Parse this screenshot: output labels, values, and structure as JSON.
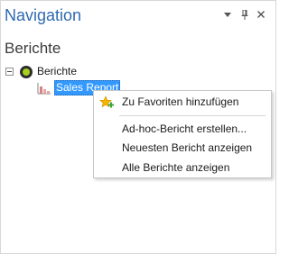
{
  "pane": {
    "title": "Navigation",
    "section_title": "Berichte"
  },
  "tree": {
    "root": {
      "label": "Berichte",
      "expanded": true,
      "status_color": "#a8d11d"
    },
    "child": {
      "label": "Sales Report",
      "selected": true
    }
  },
  "context_menu": {
    "items": [
      {
        "label": "Zu Favoriten hinzufügen",
        "icon": "star-add-icon"
      },
      {
        "label": "Ad-hoc-Bericht erstellen..."
      },
      {
        "label": "Neuesten Bericht anzeigen"
      },
      {
        "label": "Alle Berichte anzeigen"
      }
    ]
  },
  "colors": {
    "title": "#2e6ab1",
    "selection": "#3399ff",
    "star": "#f5b400",
    "plus": "#3aa63a"
  }
}
